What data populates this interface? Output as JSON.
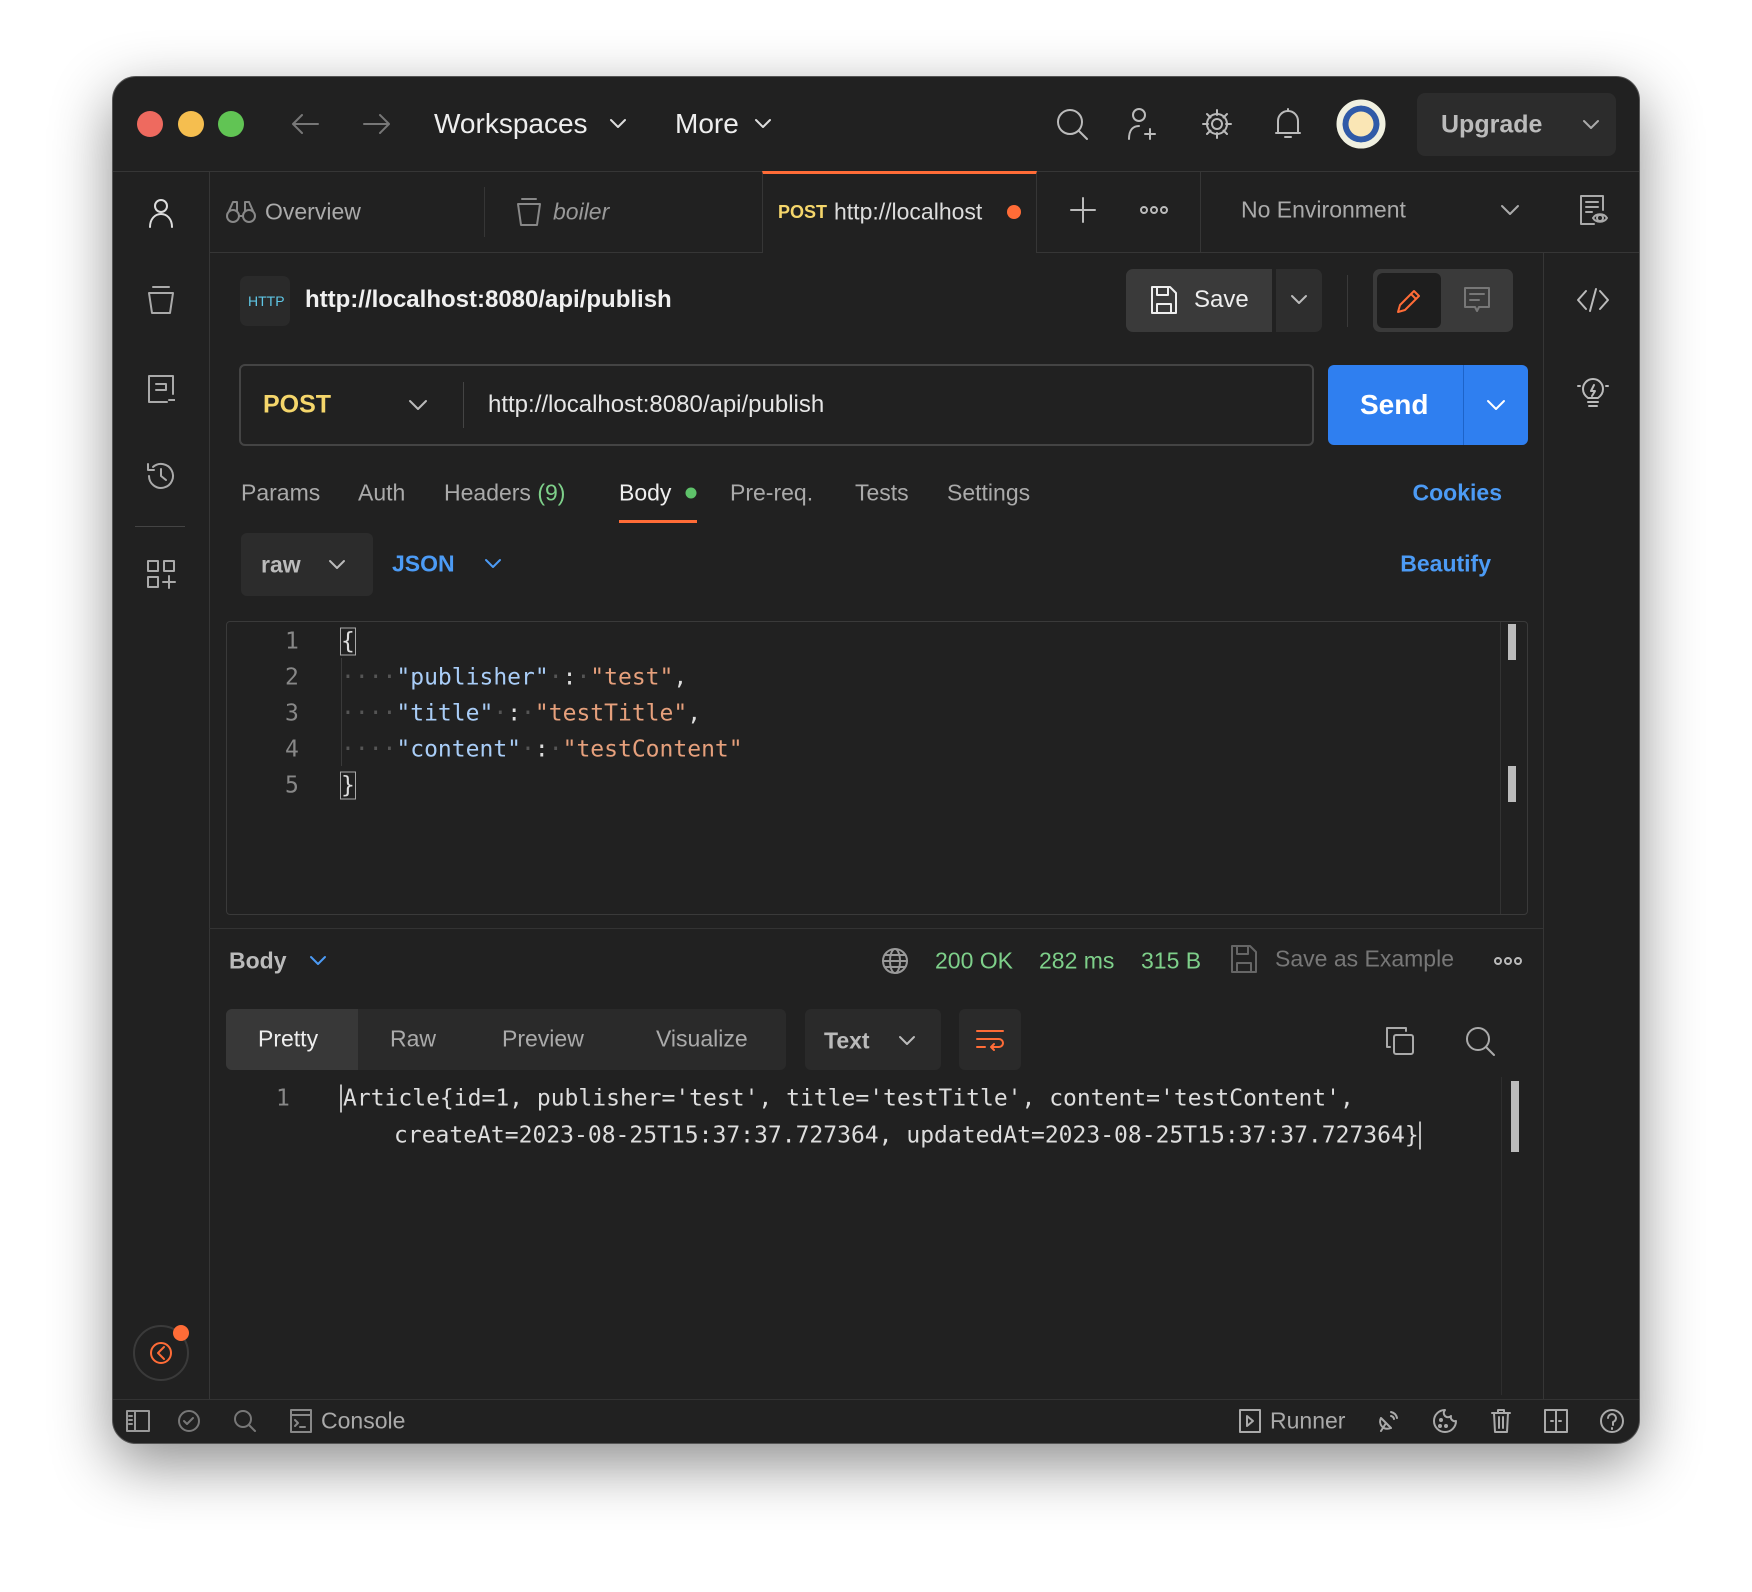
{
  "colors": {
    "accent": "#ff6c37",
    "send": "#2f7ff0",
    "link": "#4c9bf5",
    "status_ok": "#7ed08a",
    "post": "#f5d66b",
    "json_key": "#a9cdf7",
    "json_string": "#e6a07c"
  },
  "titlebar": {
    "workspaces": "Workspaces",
    "more": "More",
    "upgrade": "Upgrade"
  },
  "tabs": {
    "overview": "Overview",
    "boiler": "boiler",
    "active_method": "POST",
    "active_url": "http://localhost",
    "environment": "No Environment"
  },
  "request": {
    "title": "http://localhost:8080/api/publish",
    "save": "Save",
    "method": "POST",
    "url": "http://localhost:8080/api/publish",
    "send": "Send"
  },
  "req_tabs": {
    "params": "Params",
    "auth": "Auth",
    "headers": "Headers",
    "headers_count": "(9)",
    "body": "Body",
    "prereq": "Pre-req.",
    "tests": "Tests",
    "settings": "Settings",
    "cookies": "Cookies"
  },
  "body_opts": {
    "mode": "raw",
    "lang": "JSON",
    "beautify": "Beautify"
  },
  "editor": {
    "lines": [
      {
        "n": "1",
        "parts": [
          [
            "b",
            "{"
          ]
        ]
      },
      {
        "n": "2",
        "parts": [
          [
            "ws",
            "····"
          ],
          [
            "k",
            "\"publisher\""
          ],
          [
            "ws",
            "·"
          ],
          [
            "p",
            ":"
          ],
          [
            "ws",
            "·"
          ],
          [
            "s",
            "\"test\""
          ],
          [
            "p",
            ","
          ]
        ]
      },
      {
        "n": "3",
        "parts": [
          [
            "ws",
            "····"
          ],
          [
            "k",
            "\"title\""
          ],
          [
            "ws",
            "·"
          ],
          [
            "p",
            ":"
          ],
          [
            "ws",
            "·"
          ],
          [
            "s",
            "\"testTitle\""
          ],
          [
            "p",
            ","
          ]
        ]
      },
      {
        "n": "4",
        "parts": [
          [
            "ws",
            "····"
          ],
          [
            "k",
            "\"content\""
          ],
          [
            "ws",
            "·"
          ],
          [
            "p",
            ":"
          ],
          [
            "ws",
            "·"
          ],
          [
            "s",
            "\"testContent\""
          ]
        ]
      },
      {
        "n": "5",
        "parts": [
          [
            "b",
            "}"
          ]
        ]
      }
    ]
  },
  "response": {
    "label": "Body",
    "status": "200 OK",
    "time": "282 ms",
    "size": "315 B",
    "save_example": "Save as Example",
    "tabs": [
      "Pretty",
      "Raw",
      "Preview",
      "Visualize"
    ],
    "active_tab": "Pretty",
    "format": "Text",
    "line_no": "1",
    "line1": "Article{id=1, publisher='test', title='testTitle', content='testContent',",
    "line2": "createAt=2023-08-25T15:37:37.727364, updatedAt=2023-08-25T15:37:37.727364}"
  },
  "statusbar": {
    "console": "Console",
    "runner": "Runner"
  }
}
